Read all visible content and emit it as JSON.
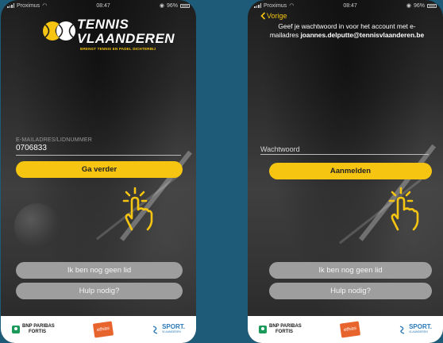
{
  "colors": {
    "accent": "#f6c512",
    "background": "#1d5b78",
    "grey_button": "#9e9e9e"
  },
  "left_screen": {
    "status": {
      "carrier": "Proximus",
      "time": "08:47",
      "battery": "96%"
    },
    "logo": {
      "line1": "TENNIS",
      "line2": "VLAANDEREN",
      "tagline": "BRENGT TENNIS EN PADEL DICHTERBIJ",
      "icon": "tennis-balls-icon"
    },
    "field": {
      "label": "E-MAILADRES/LIDNUMMER",
      "value": "0706833"
    },
    "primary_button": "Ga verder",
    "secondary_buttons": [
      "Ik ben nog geen lid",
      "Hulp nodig?"
    ],
    "pointer_icon": "tap-hand-icon",
    "sponsors": {
      "bnp_line1": "BNP PARIBAS",
      "bnp_line2": "FORTIS",
      "ethias": "ethias",
      "sport_line1": "SPORT.",
      "sport_line2": "VLAANDEREN"
    }
  },
  "right_screen": {
    "status": {
      "carrier": "Proximus",
      "time": "08:47",
      "battery": "96%"
    },
    "back_label": "Vorige",
    "instruction_line1": "Geef je wachtwoord in voor het account met e-",
    "instruction_prefix": "mailadres ",
    "instruction_email": "joannes.delputte@tennisvlaanderen.be",
    "field": {
      "placeholder": "Wachtwoord"
    },
    "primary_button": "Aanmelden",
    "secondary_buttons": [
      "Ik ben nog geen lid",
      "Hulp nodig?"
    ],
    "pointer_icon": "tap-hand-icon",
    "sponsors": {
      "bnp_line1": "BNP PARIBAS",
      "bnp_line2": "FORTIS",
      "ethias": "ethias",
      "sport_line1": "SPORT.",
      "sport_line2": "VLAANDEREN"
    }
  }
}
